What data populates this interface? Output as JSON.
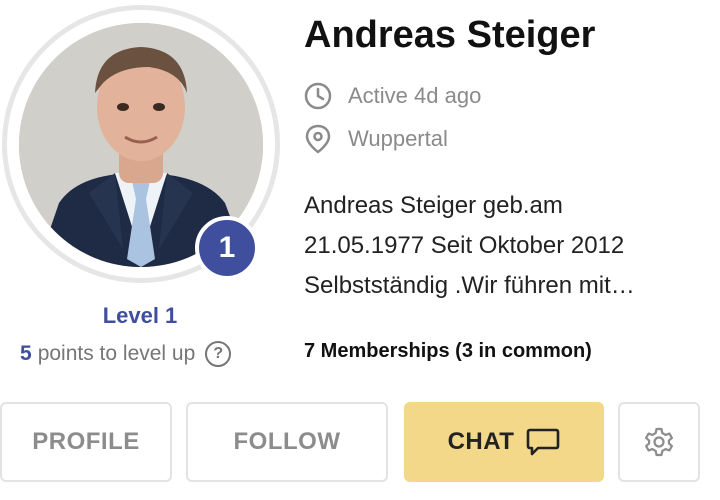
{
  "profile": {
    "name": "Andreas Steiger",
    "active": "Active 4d ago",
    "location": "Wuppertal",
    "bio": "Andreas Steiger geb.am\n21.05.1977 Seit Oktober 2012\nSelbstständig .Wir führen mit…",
    "memberships": "7 Memberships (3 in common)"
  },
  "level": {
    "badge": "1",
    "label": "Level 1",
    "points": "5",
    "points_text": "points to level up",
    "help": "?"
  },
  "actions": {
    "profile": "PROFILE",
    "follow": "FOLLOW",
    "chat": "CHAT"
  },
  "icons": {
    "active": "clock-icon",
    "location": "map-pin-icon",
    "help": "question-circle-icon",
    "chat": "chat-bubble-icon",
    "settings": "gear-icon"
  },
  "colors": {
    "accent": "#3f4f9e",
    "chat_button": "#f3d88a",
    "muted": "#8a8a8a"
  }
}
